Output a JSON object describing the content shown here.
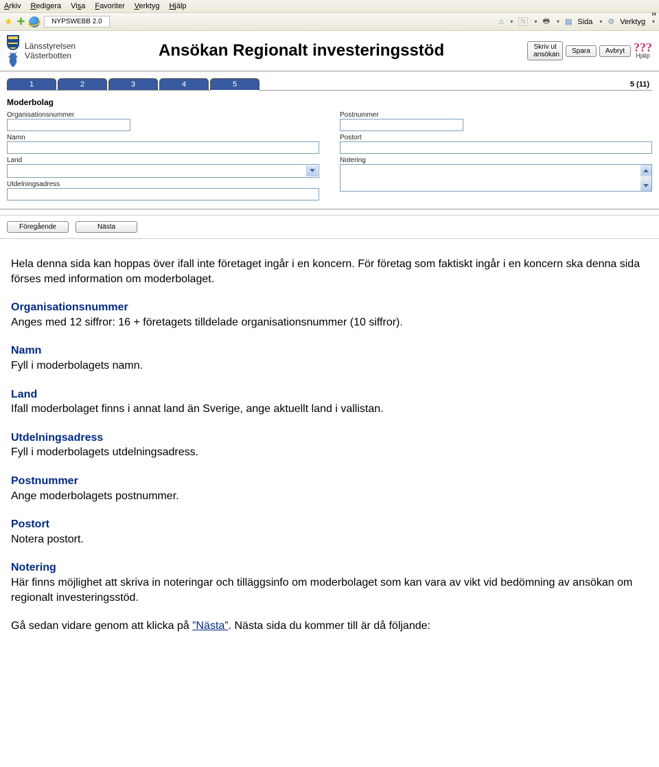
{
  "menu": {
    "items": [
      "Arkiv",
      "Redigera",
      "Visa",
      "Favoriter",
      "Verktyg",
      "Hjälp"
    ]
  },
  "browser": {
    "tab_title": "NYPSWEBB 2.0",
    "right": {
      "sida": "Sida",
      "verktyg": "Verktyg"
    },
    "chevrons": "››"
  },
  "app": {
    "org_line1": "Länsstyrelsen",
    "org_line2": "Västerbotten",
    "title": "Ansökan Regionalt investeringsstöd",
    "buttons": {
      "print_line1": "Skriv ut",
      "print_line2": "ansökan",
      "save": "Spara",
      "cancel": "Avbryt",
      "help_q": "???",
      "help_label": "Hjälp"
    }
  },
  "steps": {
    "labels": [
      "1",
      "2",
      "3",
      "4",
      "5"
    ],
    "indicator": "5 (11)",
    "active": 5
  },
  "form": {
    "heading": "Moderbolag",
    "left": {
      "orgnr_label": "Organisationsnummer",
      "orgnr_value": "",
      "namn_label": "Namn",
      "namn_value": "",
      "land_label": "Land",
      "land_value": "",
      "utdel_label": "Utdelningsadress",
      "utdel_value": ""
    },
    "right": {
      "postnr_label": "Postnummer",
      "postnr_value": "",
      "postort_label": "Postort",
      "postort_value": "",
      "notering_label": "Notering",
      "notering_value": ""
    }
  },
  "nav": {
    "prev": "Föregående",
    "next": "Nästa"
  },
  "instr": {
    "p1": "Hela denna sida kan hoppas över ifall inte företaget ingår i en koncern. För företag som faktiskt ingår i en koncern ska denna sida förses med information om moderbolaget.",
    "h2": "Organisationsnummer",
    "p2": "Anges med 12 siffror: 16 + företagets tilldelade organisationsnummer (10 siffror).",
    "h3": "Namn",
    "p3": "Fyll i moderbolagets namn.",
    "h4": "Land",
    "p4": "Ifall moderbolaget finns i annat land än Sverige, ange aktuellt land i vallistan.",
    "h5": "Utdelningsadress",
    "p5": "Fyll i moderbolagets utdelningsadress.",
    "h6": "Postnummer",
    "p6": "Ange moderbolagets postnummer.",
    "h7": "Postort",
    "p7": "Notera postort.",
    "h8": "Notering",
    "p8": "Här finns möjlighet att skriva in noteringar och tilläggsinfo om moderbolaget som kan vara av vikt vid bedömning av ansökan om regionalt investeringsstöd.",
    "p9a": "Gå sedan vidare genom att klicka på ",
    "p9link": "”Nästa”",
    "p9b": ". Nästa sida du kommer till är då följande:"
  }
}
